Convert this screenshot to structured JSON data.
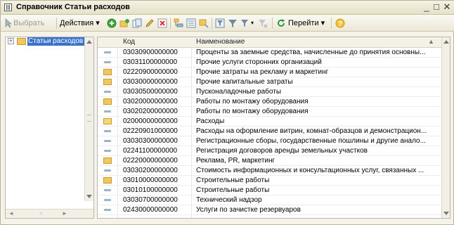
{
  "window": {
    "title": "Справочник Статьи расходов"
  },
  "toolbar": {
    "select_label": "Выбрать",
    "actions_label": "Действия",
    "goto_label": "Перейти"
  },
  "tree": {
    "root_label": "Статьи расходов"
  },
  "table": {
    "columns": [
      "Код",
      "Наименование"
    ],
    "rows": [
      {
        "kind": "item",
        "code": "03030900000000",
        "name": "Проценты за заемные средства, начисленные до принятия основны..."
      },
      {
        "kind": "item",
        "code": "03031100000000",
        "name": "Прочие услуги сторонних организаций"
      },
      {
        "kind": "folder",
        "code": "02220900000000",
        "name": "Прочие затраты на рекламу и маркетинг"
      },
      {
        "kind": "folder",
        "code": "03030000000000",
        "name": "Прочие капитальные затраты"
      },
      {
        "kind": "item",
        "code": "03030500000000",
        "name": "Пусконаладочные работы"
      },
      {
        "kind": "folder",
        "code": "03020000000000",
        "name": "Работы по монтажу оборудования"
      },
      {
        "kind": "item",
        "code": "03020200000000",
        "name": "Работы по монтажу оборудования"
      },
      {
        "kind": "folder-open",
        "code": "02000000000000",
        "name": "Расходы"
      },
      {
        "kind": "item",
        "code": "02220901000000",
        "name": "Расходы на оформление витрин, комнат-образцов и демонстрацион..."
      },
      {
        "kind": "item",
        "code": "03030300000000",
        "name": "Регистрационные сборы, государственные пошлины и другие анало..."
      },
      {
        "kind": "item",
        "code": "02241100000000",
        "name": "Регистрация договоров аренды земельных участков"
      },
      {
        "kind": "folder",
        "code": "02220000000000",
        "name": "Реклама, PR, маркетинг"
      },
      {
        "kind": "item",
        "code": "03030200000000",
        "name": "Стоимость информационных и консультационных услуг, связанных ..."
      },
      {
        "kind": "folder",
        "code": "03010000000000",
        "name": "Строительные работы"
      },
      {
        "kind": "item",
        "code": "03010100000000",
        "name": "Строительные работы"
      },
      {
        "kind": "item",
        "code": "03030700000000",
        "name": "Технический надзор"
      },
      {
        "kind": "item",
        "code": "02430000000000",
        "name": "Услуги по зачистке резервуаров"
      }
    ]
  }
}
